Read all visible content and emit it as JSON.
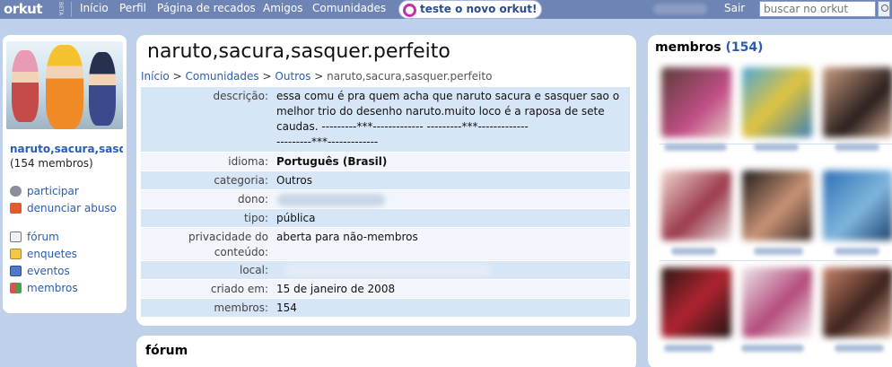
{
  "topbar": {
    "logo": "orkut",
    "beta": "BETA",
    "nav": [
      "Início",
      "Perfil",
      "Página de recados",
      "Amigos",
      "Comunidades"
    ],
    "new_orkut_button": "teste o novo orkut!",
    "sair": "Sair",
    "search_placeholder": "buscar no orkut"
  },
  "left": {
    "community_name": "naruto,sacura,sasquer.perfeito",
    "member_count": "(154 membros)",
    "actions": [
      "participar",
      "denunciar abuso"
    ],
    "sections": [
      "fórum",
      "enquetes",
      "eventos",
      "membros"
    ]
  },
  "main": {
    "title": "naruto,sacura,sasquer.perfeito",
    "breadcrumb": {
      "home": "Início",
      "sep": ">",
      "communities": "Comunidades",
      "category": "Outros",
      "current": "naruto,sacura,sasquer.perfeito"
    },
    "fields": {
      "descricao_label": "descrição:",
      "descricao_value": "essa comu é pra quem acha que naruto sacura e sasquer sao o melhor trio do desenho naruto.muito loco é a raposa de sete caudas. ---------***------------- ---------***-------------\n---------***-------------",
      "idioma_label": "idioma:",
      "idioma_value": "Português (Brasil)",
      "categoria_label": "categoria:",
      "categoria_value": "Outros",
      "dono_label": "dono:",
      "tipo_label": "tipo:",
      "tipo_value": "pública",
      "privacidade_label": "privacidade do conteúdo:",
      "privacidade_value": "aberta para não-membros",
      "local_label": "local:",
      "criado_label": "criado em:",
      "criado_value": "15 de janeiro de 2008",
      "membros_label": "membros:",
      "membros_value": "154"
    }
  },
  "forum": {
    "title": "fórum"
  },
  "right": {
    "title": "membros",
    "count": "(154)"
  },
  "colors": {
    "background": "#bfd0ea",
    "topbar": "#6d84b4",
    "link": "#2a5db0",
    "row_blue": "#d6e6f7",
    "new_orkut_accent": "#c431a8"
  }
}
